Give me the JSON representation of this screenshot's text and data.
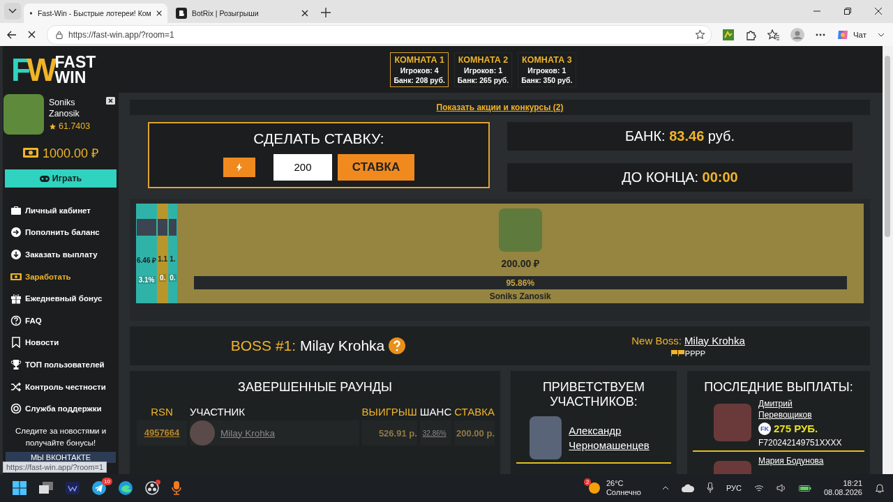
{
  "browser": {
    "tabs": [
      {
        "title": "Fast-Win - Быстрые лотереи! Ком",
        "selected": true,
        "loading": true
      },
      {
        "title": "BotRix | Розыгрыши",
        "selected": false,
        "loading": false
      }
    ],
    "url": "https://fast-win.app/?room=1",
    "chat_button": "Чат"
  },
  "logo": {
    "mark_1": "F",
    "mark_2": "W",
    "line_1": "FAST",
    "line_2": "WIN"
  },
  "rooms": [
    {
      "name": "КОМНАТА 1",
      "players": "Игроков: 4",
      "bank": "Банк: 208 руб.",
      "selected": true
    },
    {
      "name": "КОМНАТА 2",
      "players": "Игроков: 1",
      "bank": "Банк: 265 руб.",
      "selected": false
    },
    {
      "name": "КОМНАТА 3",
      "players": "Игроков: 1",
      "bank": "Банк: 350 руб.",
      "selected": false
    }
  ],
  "profile": {
    "name": "Soniks Zanosik",
    "rating": "61.7403",
    "balance": "1000.00 ₽"
  },
  "play_button": "Играть",
  "menu": [
    {
      "label": "Личный кабинет",
      "selected": false
    },
    {
      "label": "Пополнить баланс",
      "selected": false
    },
    {
      "label": "Заказать выплату",
      "selected": false
    },
    {
      "label": "Заработать",
      "selected": true
    },
    {
      "label": "Ежедневный бонус",
      "selected": false
    },
    {
      "label": "FAQ",
      "selected": false
    },
    {
      "label": "Новости",
      "selected": false
    },
    {
      "label": "ТОП пользователей",
      "selected": false
    },
    {
      "label": "Контроль честности",
      "selected": false
    },
    {
      "label": "Служба поддержки",
      "selected": false
    }
  ],
  "news_note": "Следите за новостями и получайте бонусы!",
  "vk_button": "МЫ ВКОНТАКТЕ",
  "status_link": "https://fast-win.app/?room=1",
  "promo_link": "Показать акции и конкурсы (2)",
  "bet": {
    "title": "СДЕЛАТЬ СТАВКУ:",
    "amount": "200",
    "submit": "СТАВКА"
  },
  "bank": {
    "label": "БАНК:",
    "value": "83.46",
    "unit": "руб."
  },
  "timer": {
    "label": "ДО КОНЦА:",
    "value": "00:00"
  },
  "game": {
    "players": [
      {
        "amount": "6.46 ₽",
        "share": "3.1%",
        "color": "#2fb3a8"
      },
      {
        "amount": "1.1",
        "share": "0.",
        "color": "#b8962c"
      },
      {
        "amount": "1.",
        "share": "0.",
        "color": "#2fb3a8"
      }
    ],
    "leader": {
      "amount": "200.00 ₽",
      "share": "95.86%",
      "name": "Soniks Zanosik",
      "color": "#958540"
    }
  },
  "boss": {
    "title": "BOSS #1:",
    "name": "Milay Krohka",
    "new_label": "New Boss:",
    "new_name": "Milay Krohka",
    "flags": "PPPP"
  },
  "rounds": {
    "title": "ЗАВЕРШЕННЫЕ РАУНДЫ",
    "columns": [
      "RSN",
      "УЧАСТНИК",
      "ВЫИГРЫШ",
      "ШАНС",
      "СТАВКА"
    ],
    "rows": [
      {
        "rsn": "4957664",
        "player": "Milay Krohka",
        "win": "526.91 р.",
        "chance": "32.86%",
        "bet": "200.00 р."
      }
    ]
  },
  "welcome": {
    "title": "ПРИВЕТСТВУЕМ УЧАСТНИКОВ:",
    "users": [
      {
        "name": "Александр Черномашенцев"
      }
    ]
  },
  "payouts": {
    "title": "ПОСЛЕДНИЕ ВЫПЛАТЫ:",
    "items": [
      {
        "name": "Дмитрий Перевощиков",
        "method": "FK",
        "amount": "275 РУБ.",
        "wallet": "F720242149751XXXX"
      },
      {
        "name": "Мария Бодунова"
      }
    ]
  },
  "taskbar": {
    "telegram_badge": "10",
    "weather_badge": "2",
    "temperature": "26°C",
    "weather": "Солнечно",
    "language": "РУС",
    "time": "18:21",
    "date": "08.08.2026"
  }
}
